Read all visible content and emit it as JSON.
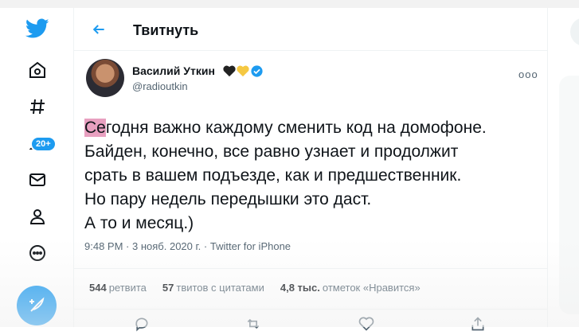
{
  "header": {
    "title": "Твитнуть"
  },
  "nav": {
    "badge_count": "20+"
  },
  "author": {
    "name": "Василий Уткин",
    "handle": "@radioutkin"
  },
  "tweet": {
    "first_highlight": "Се",
    "first_rest": "годня важно каждому сменить код на домофоне.",
    "lines": [
      "Байден, конечно, все равно узнает и продолжит",
      "срать в вашем подъезде, как и предшественник.",
      "Но пару недель передышки это даст.",
      "А то и месяц.)"
    ]
  },
  "meta": {
    "time": "9:48 PM",
    "date": "3 нояб. 2020 г.",
    "client": "Twitter for iPhone",
    "separator": "·"
  },
  "stats": {
    "retweets_count": "544",
    "retweets_label": "ретвита",
    "quotes_count": "57",
    "quotes_label": "твитов с цитатами",
    "likes_count": "4,8 тыс.",
    "likes_label": "отметок «Нравится»"
  },
  "colors": {
    "accent": "#1d9bf0",
    "text": "#0f1419",
    "muted": "#536471"
  }
}
